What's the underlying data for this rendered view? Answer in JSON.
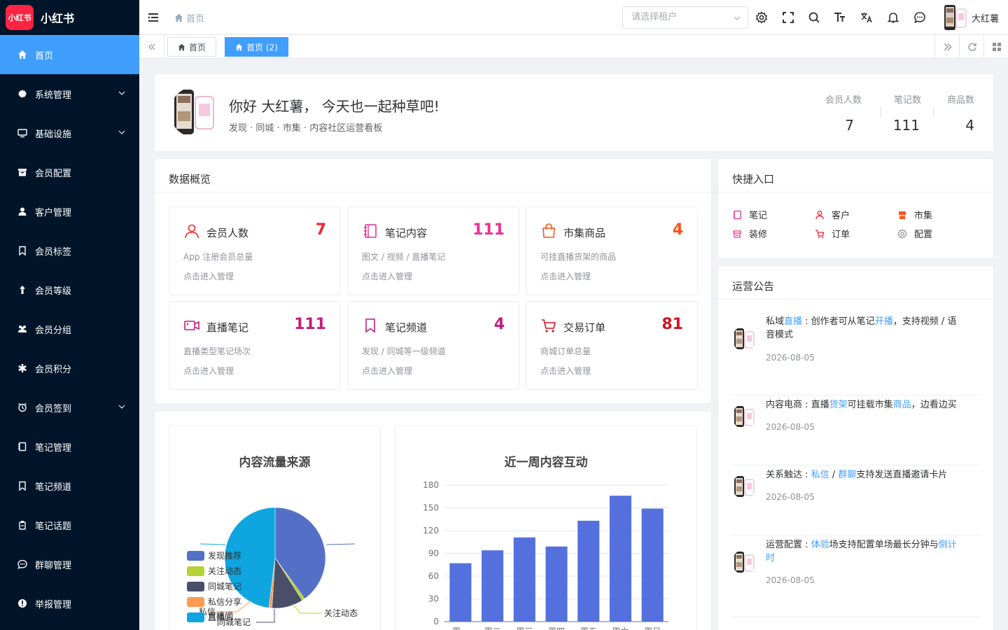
{
  "sidebar": {
    "logo_badge": "小红书",
    "logo_text": "小红书",
    "items": [
      {
        "label": "首页",
        "active": true
      },
      {
        "label": "系统管理",
        "arrow": true
      },
      {
        "label": "基础设施",
        "arrow": true
      },
      {
        "label": "会员配置"
      },
      {
        "label": "客户管理"
      },
      {
        "label": "会员标签"
      },
      {
        "label": "会员等级"
      },
      {
        "label": "会员分组"
      },
      {
        "label": "会员积分"
      },
      {
        "label": "会员签到",
        "arrow": true
      },
      {
        "label": "笔记管理"
      },
      {
        "label": "笔记频道"
      },
      {
        "label": "笔记话题"
      },
      {
        "label": "群聊管理"
      },
      {
        "label": "举报管理"
      }
    ]
  },
  "header": {
    "breadcrumb": "首页",
    "tenant_placeholder": "请选择租户",
    "username": "大红薯"
  },
  "tabs": [
    {
      "label": "首页",
      "active": false
    },
    {
      "label": "首页 (2)",
      "active": true
    }
  ],
  "welcome": {
    "greeting": "你好 大红薯， 今天也一起种草吧!",
    "subtitle": "发现 · 同城 · 市集 · 内容社区运营看板",
    "stats": [
      {
        "label": "会员人数",
        "value": "7"
      },
      {
        "label": "笔记数",
        "value": "111"
      },
      {
        "label": "商品数",
        "value": "4"
      }
    ]
  },
  "overview": {
    "title": "数据概览",
    "tiles": [
      {
        "title": "会员人数",
        "value": "7",
        "desc": "App 注册会员总量",
        "link": "点击进入管理",
        "color": "#f5222d"
      },
      {
        "title": "笔记内容",
        "value": "111",
        "desc": "图文 / 视频 / 直播笔记",
        "link": "点击进入管理",
        "color": "#eb2f96"
      },
      {
        "title": "市集商品",
        "value": "4",
        "desc": "可挂直播货架的商品",
        "link": "点击进入管理",
        "color": "#fa541c"
      },
      {
        "title": "直播笔记",
        "value": "111",
        "desc": "直播类型笔记场次",
        "link": "点击进入管理",
        "color": "#c41d7f"
      },
      {
        "title": "笔记频道",
        "value": "4",
        "desc": "发现 / 同城等一级频道",
        "link": "点击进入管理",
        "color": "#c41d7f"
      },
      {
        "title": "交易订单",
        "value": "81",
        "desc": "商城订单总量",
        "link": "点击进入管理",
        "color": "#cf1322"
      }
    ]
  },
  "quick": {
    "title": "快捷入口",
    "items": [
      {
        "label": "笔记",
        "color": "#eb2f96"
      },
      {
        "label": "客户",
        "color": "#f5222d"
      },
      {
        "label": "市集",
        "color": "#fa541c"
      },
      {
        "label": "装修",
        "color": "#eb2f96"
      },
      {
        "label": "订单",
        "color": "#f5222d"
      },
      {
        "label": "配置",
        "color": "#909399"
      }
    ]
  },
  "notices": {
    "title": "运营公告",
    "items": [
      {
        "parts": [
          [
            "私域",
            0
          ],
          [
            "直播",
            1
          ],
          [
            " : 创作者可从笔记",
            0
          ],
          [
            "开播",
            1
          ],
          [
            "，支持视频 / 语",
            0
          ]
        ],
        "line2": "音模式",
        "date": "2026-08-05"
      },
      {
        "parts": [
          [
            "内容电商 : 直播",
            0
          ],
          [
            "货架",
            1
          ],
          [
            "可挂载市集",
            0
          ],
          [
            "商品",
            1
          ],
          [
            "，边看边买",
            0
          ]
        ],
        "line2": "",
        "date": "2026-08-05"
      },
      {
        "parts": [
          [
            "关系触达 : ",
            0
          ],
          [
            "私信",
            1
          ],
          [
            " / ",
            0
          ],
          [
            "群聊",
            1
          ],
          [
            "支持发送直播邀请卡片",
            0
          ]
        ],
        "line2": "",
        "date": "2026-08-05"
      },
      {
        "parts": [
          [
            "运营配置 : ",
            0
          ],
          [
            "体验",
            1
          ],
          [
            "场支持配置单场最长分钟与",
            0
          ],
          [
            "倒计",
            1
          ]
        ],
        "line2": "时",
        "line2_link": true,
        "date": "2026-08-05"
      }
    ]
  },
  "chart_data": [
    {
      "type": "pie",
      "title": "内容流量来源",
      "categories": [
        "发现推荐",
        "关注动态",
        "同城笔记",
        "私信分享",
        "直播间"
      ],
      "values": [
        40,
        1,
        10,
        1,
        48
      ],
      "colors": [
        "#5470c6",
        "#b5d334",
        "#4a4e69",
        "#ff9a52",
        "#0ea5e0"
      ],
      "slice_labels": [
        "关注动态",
        "同城笔记",
        "私信",
        "直播间"
      ]
    },
    {
      "type": "bar",
      "title": "近一周内容互动",
      "categories": [
        "周一",
        "周二",
        "周三",
        "周四",
        "周五",
        "周六",
        "周日"
      ],
      "values": [
        77,
        94,
        111,
        99,
        133,
        166,
        149
      ],
      "ylim": [
        0,
        180
      ],
      "yticks": [
        0,
        30,
        60,
        90,
        120,
        150,
        180
      ],
      "color": "#5470dc"
    }
  ]
}
